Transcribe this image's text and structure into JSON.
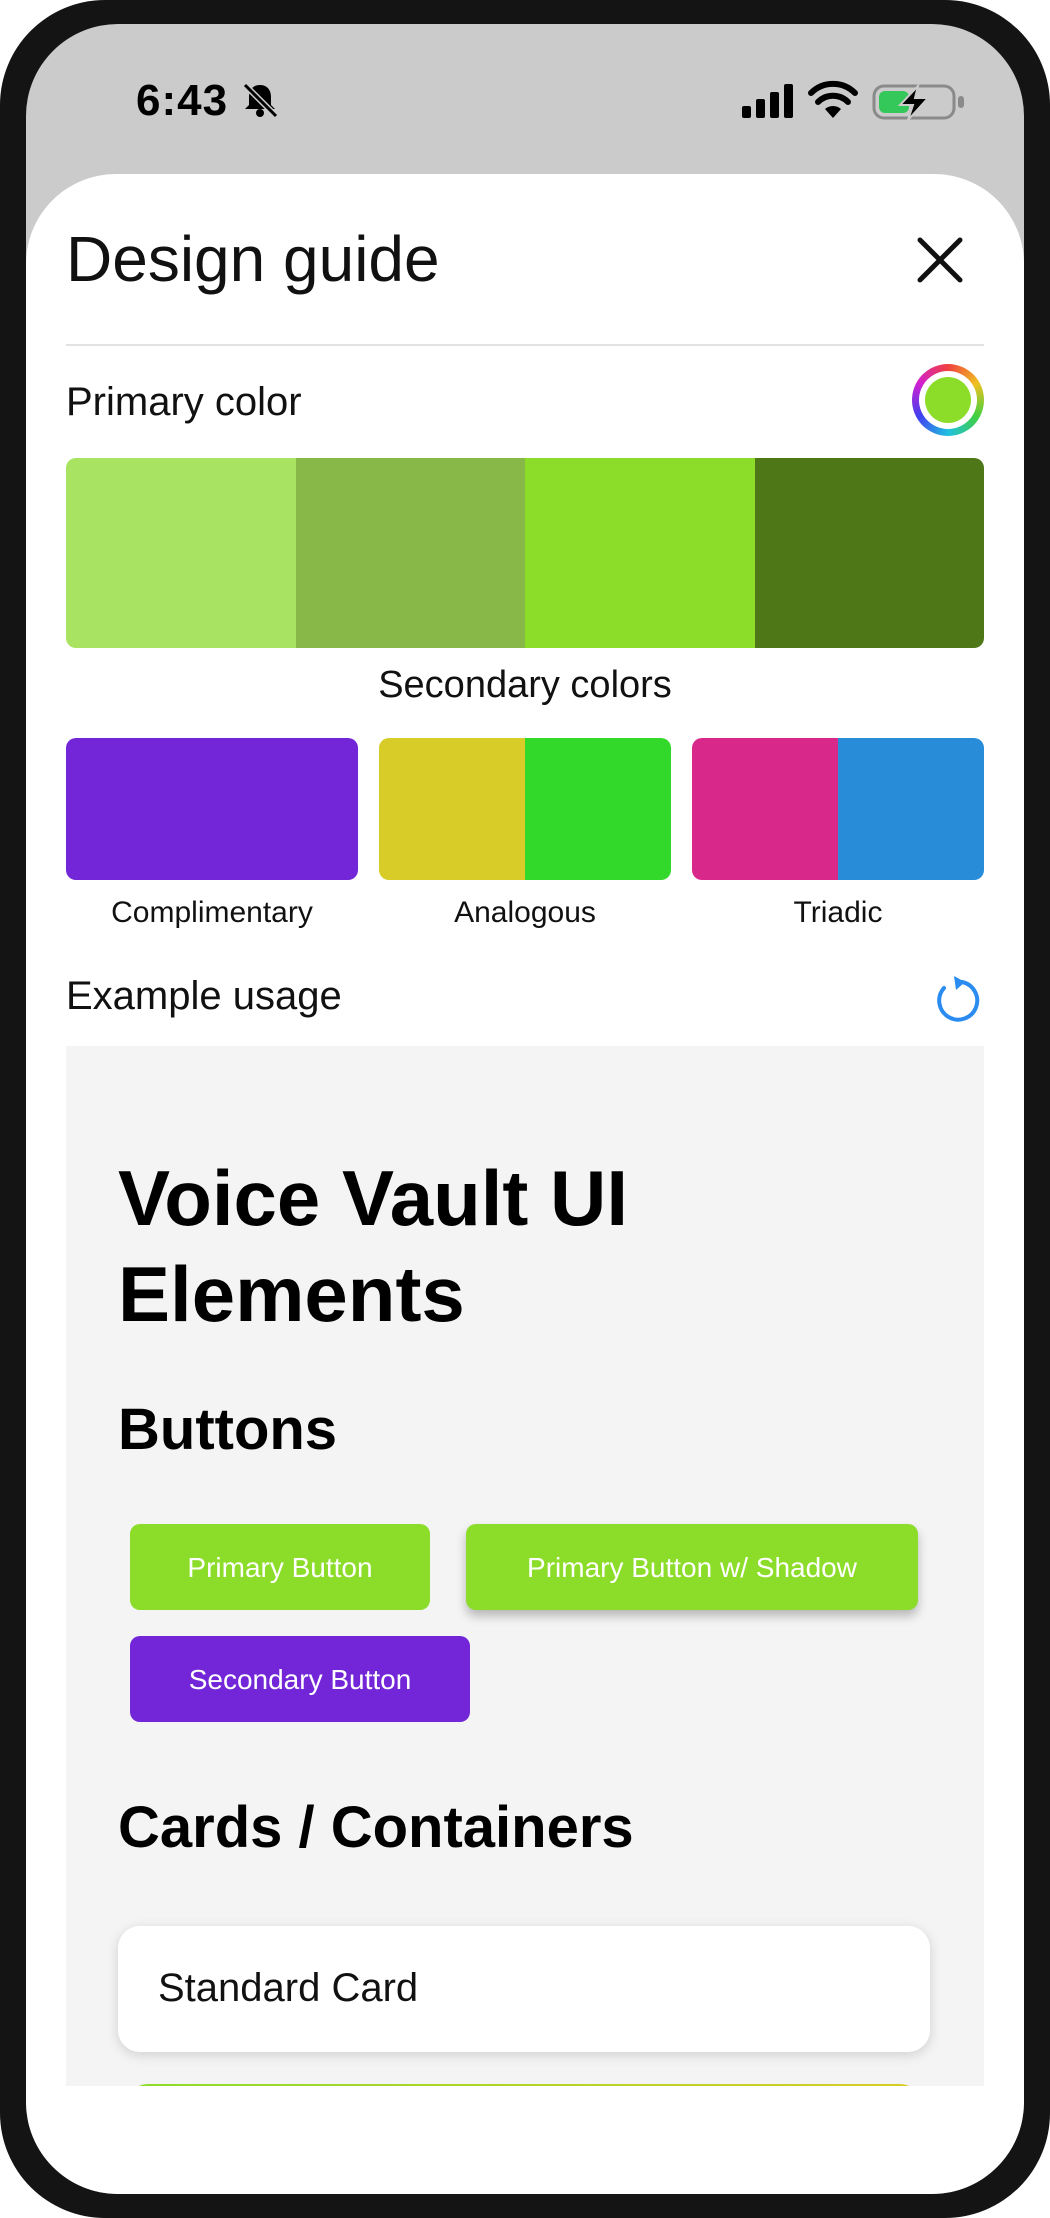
{
  "status_bar": {
    "time": "6:43",
    "icons": [
      "bell-slash-icon",
      "signal-icon",
      "wifi-icon",
      "battery-charging-icon"
    ]
  },
  "sheet": {
    "title": "Design guide",
    "close_icon": "close-icon"
  },
  "primary": {
    "label": "Primary color",
    "picker_color": "#8cdc2a",
    "shades": [
      "#a8e462",
      "#88b848",
      "#8cdc2a",
      "#4e7818"
    ]
  },
  "secondary": {
    "label": "Secondary colors",
    "groups": [
      {
        "name": "Complimentary",
        "colors": [
          "#7326d8"
        ]
      },
      {
        "name": "Analogous",
        "colors": [
          "#d8cc28",
          "#32d92a"
        ]
      },
      {
        "name": "Triadic",
        "colors": [
          "#d8288a",
          "#288cd8"
        ]
      }
    ]
  },
  "example": {
    "label": "Example usage",
    "refresh_icon": "refresh-icon",
    "heading": "Voice Vault UI Elements",
    "buttons_heading": "Buttons",
    "primary_button": "Primary Button",
    "primary_shadow_button": "Primary Button w/ Shadow",
    "secondary_button": "Secondary Button",
    "cards_heading": "Cards / Containers",
    "standard_card": "Standard Card"
  }
}
